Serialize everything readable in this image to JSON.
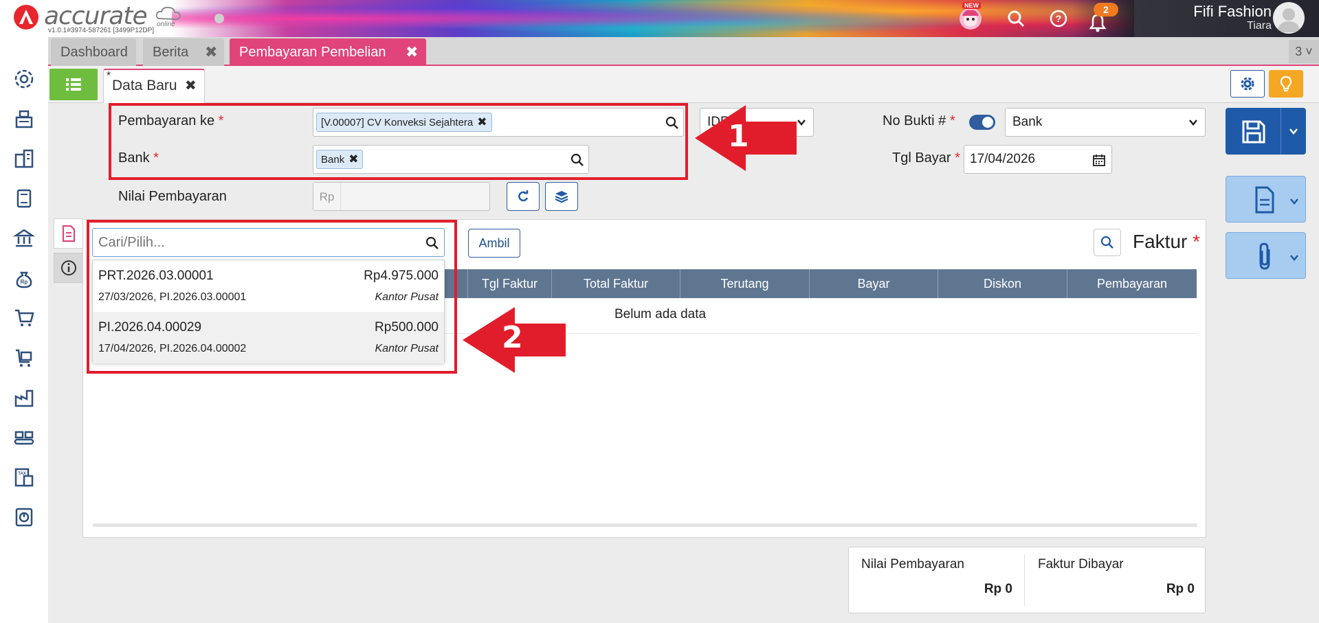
{
  "header": {
    "logo_text": "accurate",
    "logo_online": "online",
    "version": "v1.0.1#3974-587261 [3499P12DP]",
    "new_badge": "NEW",
    "notification_count": "2",
    "user_name": "Fifi Fashion",
    "user_sub": "Tiara",
    "icons": [
      "new-mascot-icon",
      "search-icon",
      "help-icon",
      "bell-icon",
      "avatar"
    ]
  },
  "sidebar": {
    "items": [
      {
        "name": "settings",
        "icon": "gear-icon"
      },
      {
        "name": "cashier",
        "icon": "cash-register-icon"
      },
      {
        "name": "company",
        "icon": "building-icon"
      },
      {
        "name": "ledger",
        "icon": "book-icon"
      },
      {
        "name": "bank",
        "icon": "bank-icon"
      },
      {
        "name": "payment",
        "icon": "money-bag-icon"
      },
      {
        "name": "sales",
        "icon": "cart-icon"
      },
      {
        "name": "purchase",
        "icon": "purchase-cart-icon"
      },
      {
        "name": "warehouse",
        "icon": "factory-icon"
      },
      {
        "name": "inventory",
        "icon": "conveyor-icon"
      },
      {
        "name": "tax",
        "icon": "tax-icon"
      },
      {
        "name": "reports",
        "icon": "report-chart-icon"
      }
    ]
  },
  "tabs": {
    "items": [
      {
        "label": "Dashboard"
      },
      {
        "label": "Berita"
      },
      {
        "label": "Pembayaran Pembelian"
      }
    ],
    "close_symbol": "✖",
    "counter": "3"
  },
  "subbar": {
    "tab_label": "Data Baru",
    "star": "*",
    "close_symbol": "✖"
  },
  "form": {
    "pembayaran_ke_label": "Pembayaran ke",
    "pembayaran_ke_value": "[V.00007] CV Konveksi Sejahtera",
    "bank_label": "Bank",
    "bank_value": "Bank",
    "nilai_label": "Nilai Pembayaran",
    "rp_prefix": "Rp",
    "currency_select": "IDR",
    "no_bukti_label": "No Bukti #",
    "no_bukti_select": "Bank",
    "tgl_bayar_label": "Tgl Bayar",
    "tgl_bayar_value": "17/04/2026",
    "required_mark": "*",
    "chip_close": "✖"
  },
  "panel": {
    "ambil_label": "Ambil",
    "faktur_title": "Faktur",
    "required_mark": "*",
    "columns": [
      "Tgl Faktur",
      "Total Faktur",
      "Terutang",
      "Bayar",
      "Diskon",
      "Pembayaran"
    ],
    "empty_text": "Belum ada data"
  },
  "dropdown": {
    "placeholder": "Cari/Pilih...",
    "items": [
      {
        "code": "PRT.2026.03.00001",
        "amount": "Rp4.975.000",
        "sub": "27/03/2026, PI.2026.03.00001",
        "branch": "Kantor Pusat"
      },
      {
        "code": "PI.2026.04.00029",
        "amount": "Rp500.000",
        "sub": "17/04/2026, PI.2026.04.00002",
        "branch": "Kantor Pusat"
      }
    ]
  },
  "annotations": {
    "one": "1",
    "two": "2",
    "color": "#e21d2b"
  },
  "summary": {
    "nilai_label": "Nilai Pembayaran",
    "nilai_value": "Rp 0",
    "faktur_label": "Faktur Dibayar",
    "faktur_value": "Rp 0"
  },
  "colors": {
    "accent_pink": "#e0447a",
    "primary_blue": "#1f5aa8",
    "green": "#6fbd3f",
    "orange": "#f5a623",
    "table_header": "#5f7690",
    "sidebar_icon": "#2f4f7a"
  }
}
